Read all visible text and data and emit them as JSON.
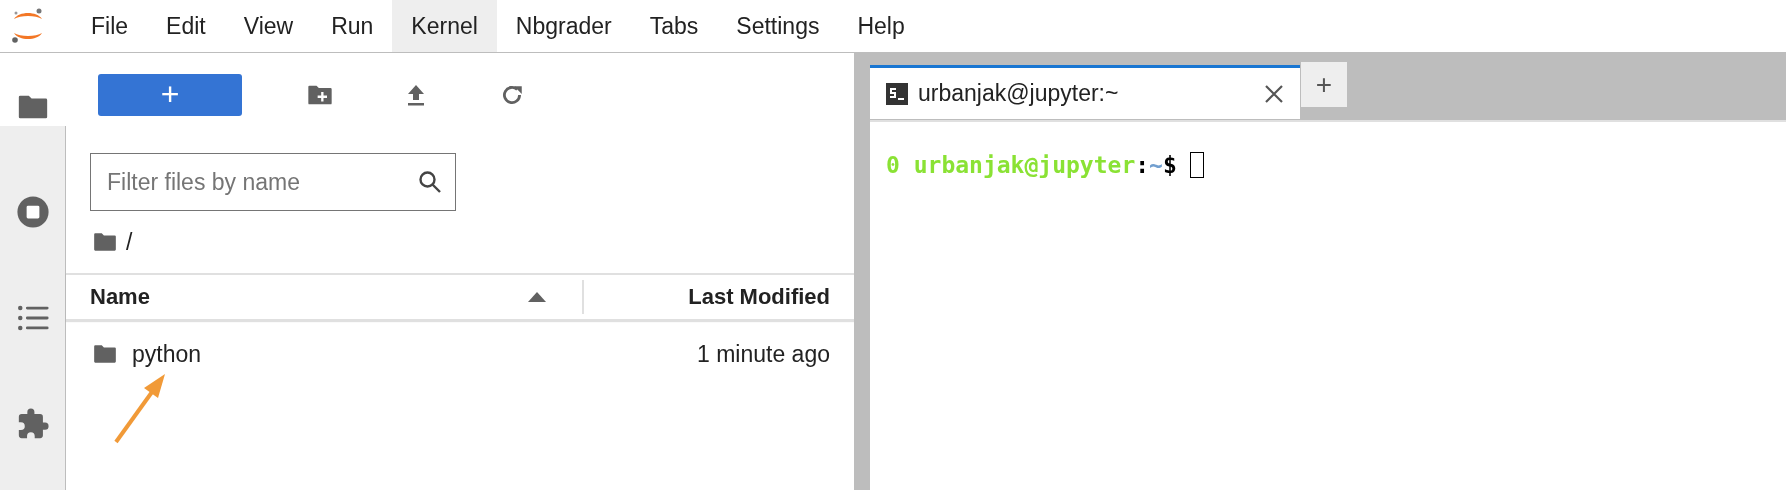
{
  "menu_bar": {
    "items": [
      {
        "label": "File",
        "selected": false
      },
      {
        "label": "Edit",
        "selected": false
      },
      {
        "label": "View",
        "selected": false
      },
      {
        "label": "Run",
        "selected": false
      },
      {
        "label": "Kernel",
        "selected": true
      },
      {
        "label": "Nbgrader",
        "selected": false
      },
      {
        "label": "Tabs",
        "selected": false
      },
      {
        "label": "Settings",
        "selected": false
      },
      {
        "label": "Help",
        "selected": false
      }
    ]
  },
  "sidebar": {
    "tabs": [
      {
        "kind": "folder",
        "selected": true
      },
      {
        "kind": "running",
        "selected": false
      },
      {
        "kind": "toc",
        "selected": false
      },
      {
        "kind": "extensions",
        "selected": false
      }
    ]
  },
  "file_browser": {
    "new_button": "+",
    "filter": {
      "placeholder": "Filter files by name"
    },
    "breadcrumb": "/",
    "columns": [
      {
        "label": "Name",
        "sorted": true
      },
      {
        "label": "Last Modified"
      }
    ],
    "rows": [
      {
        "kind": "folder",
        "name": "python",
        "modified": "1 minute ago",
        "selected": false
      }
    ]
  },
  "terminal": {
    "tabs": [
      {
        "title": "urbanjak@jupyter:~",
        "selected": true
      }
    ],
    "add_tab": "+",
    "prompt": [
      {
        "text": "0 urbanjak@jupyter",
        "color": "#8ae234"
      },
      {
        "text": ":",
        "color": "#000000"
      },
      {
        "text": "~",
        "color": "#729fcf"
      },
      {
        "text": "$",
        "color": "#000000"
      }
    ]
  },
  "annotations": [
    {
      "kind": "arrow"
    }
  ]
}
